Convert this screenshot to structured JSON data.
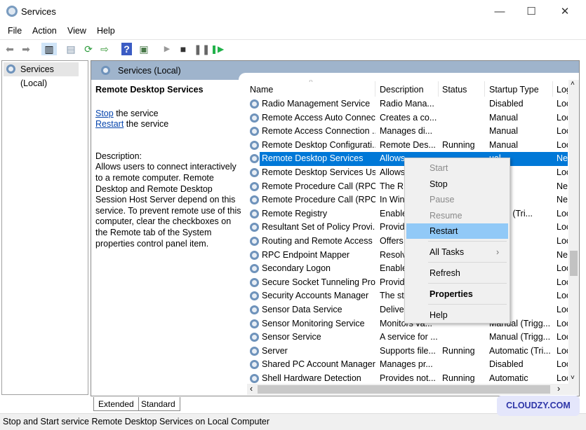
{
  "window": {
    "title": "Services",
    "minimize": "—",
    "maximize": "☐",
    "close": "✕"
  },
  "menubar": [
    "File",
    "Action",
    "View",
    "Help"
  ],
  "toolbar": {
    "icons": [
      "back-icon",
      "forward-icon",
      "show-hide-console-tree-icon",
      "export-icon",
      "refresh-icon",
      "export-list-icon",
      "help-icon",
      "properties-pane-icon",
      "start-service-icon",
      "stop-service-icon",
      "pause-service-icon",
      "resume-service-icon"
    ]
  },
  "tree": {
    "item": "Services (Local)"
  },
  "pane": {
    "header": "Services (Local)"
  },
  "details": {
    "service_name": "Remote Desktop Services",
    "stop_link": "Stop",
    "stop_suffix": " the service",
    "restart_link": "Restart",
    "restart_suffix": " the service",
    "description_label": "Description:",
    "description": "Allows users to connect interactively to a remote computer. Remote Desktop and Remote Desktop Session Host Server depend on this service. To prevent remote use of this computer, clear the checkboxes on the Remote tab of the System properties control panel item."
  },
  "list": {
    "columns": [
      "Name",
      "Description",
      "Status",
      "Startup Type",
      "Log"
    ],
    "rows": [
      [
        "Radio Management Service",
        "Radio Mana...",
        "",
        "Disabled",
        "Loc"
      ],
      [
        "Remote Access Auto Connec...",
        "Creates a co...",
        "",
        "Manual",
        "Loc"
      ],
      [
        "Remote Access Connection ...",
        "Manages di...",
        "",
        "Manual",
        "Loc"
      ],
      [
        "Remote Desktop Configurati...",
        "Remote Des...",
        "Running",
        "Manual",
        "Loc"
      ],
      [
        "Remote Desktop Services",
        "Allows",
        "",
        "ual",
        "Ne"
      ],
      [
        "Remote Desktop Services Us...",
        "Allows",
        "",
        "ual",
        "Loc"
      ],
      [
        "Remote Procedure Call (RPC)",
        "The RP",
        "",
        "matic",
        "Ne"
      ],
      [
        "Remote Procedure Call (RPC)...",
        "In Win",
        "",
        "ual",
        "Ne"
      ],
      [
        "Remote Registry",
        "Enable",
        "",
        "matic (Tri...",
        "Loc"
      ],
      [
        "Resultant Set of Policy Provi...",
        "Provid",
        "",
        "ual",
        "Loc"
      ],
      [
        "Routing and Remote Access",
        "Offers",
        "",
        "bled",
        "Loc"
      ],
      [
        "RPC Endpoint Mapper",
        "Resolv",
        "",
        "matic",
        "Ne"
      ],
      [
        "Secondary Logon",
        "Enable",
        "",
        "ual",
        "Loc"
      ],
      [
        "Secure Socket Tunneling Pro...",
        "Provid",
        "",
        "ual",
        "Loc"
      ],
      [
        "Security Accounts Manager",
        "The sta",
        "",
        "matic",
        "Loc"
      ],
      [
        "Sensor Data Service",
        "Delive",
        "",
        "bled",
        "Loc"
      ],
      [
        "Sensor Monitoring Service",
        "Monitors va...",
        "",
        "Manual (Trigg...",
        "Loc"
      ],
      [
        "Sensor Service",
        "A service for ...",
        "",
        "Manual (Trigg...",
        "Loc"
      ],
      [
        "Server",
        "Supports file...",
        "Running",
        "Automatic (Tri...",
        "Loc"
      ],
      [
        "Shared PC Account Manager",
        "Manages pr...",
        "",
        "Disabled",
        "Loc"
      ],
      [
        "Shell Hardware Detection",
        "Provides not...",
        "Running",
        "Automatic",
        "Loc"
      ]
    ],
    "selected_index": 4,
    "selection_color": "#0078d7"
  },
  "context_menu": {
    "items": [
      "Start",
      "Stop",
      "Pause",
      "Resume",
      "Restart",
      "All Tasks",
      "Refresh",
      "Properties",
      "Help"
    ],
    "disabled": [
      "Start",
      "Pause",
      "Resume"
    ],
    "highlighted": "Restart",
    "submenu_arrow": "›"
  },
  "tabs": [
    "Extended",
    "Standard"
  ],
  "status": "Stop and Start service Remote Desktop Services on Local Computer",
  "watermark": "CLOUDZY.COM",
  "scroll": {
    "left_arrow": "‹",
    "right_arrow": "›",
    "up_arrow": "˄",
    "down_arrow": "˅"
  }
}
